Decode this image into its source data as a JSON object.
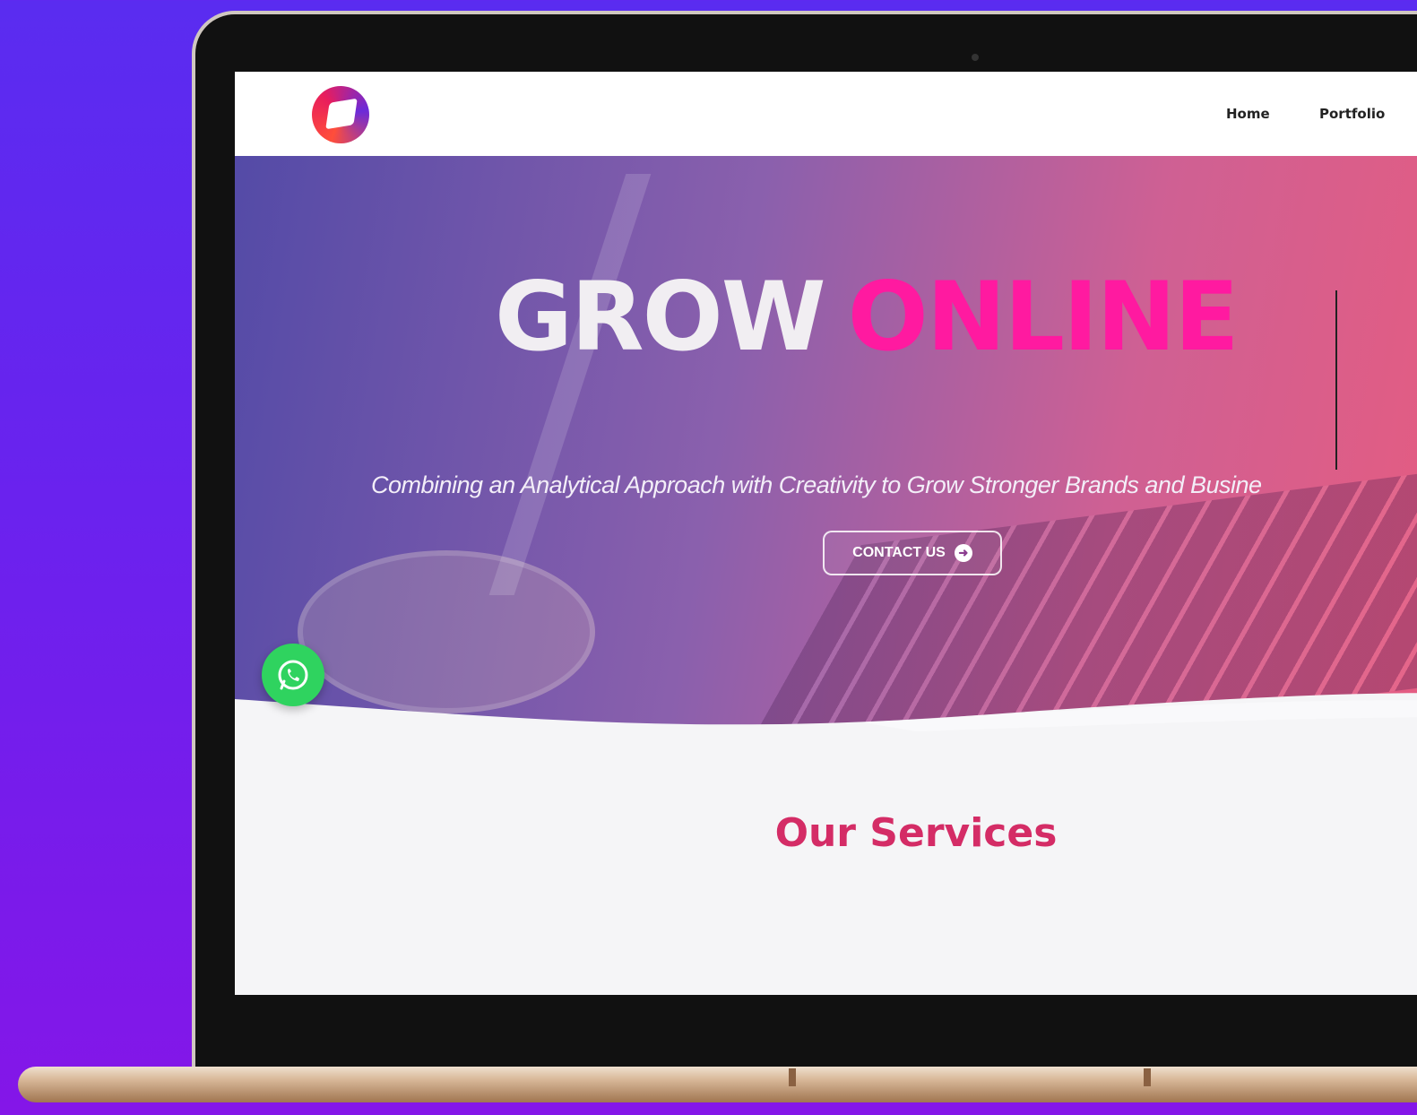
{
  "nav": {
    "items": [
      {
        "label": "Home"
      },
      {
        "label": "Portfolio"
      }
    ]
  },
  "hero": {
    "headline_part1": "GROW",
    "headline_part2": "ONLINE",
    "subtitle": "Combining an Analytical Approach with Creativity to Grow Stronger Brands and Busine",
    "cta_label": "CONTACT US",
    "cta_icon": "arrow-right-circle-icon"
  },
  "floating": {
    "whatsapp_icon": "whatsapp-icon"
  },
  "services": {
    "title": "Our Services"
  },
  "colors": {
    "accent_pink": "#ff1aa0",
    "services_title": "#d42c66",
    "whatsapp_green": "#2fd35f",
    "background_purple": "#6a22ee"
  }
}
